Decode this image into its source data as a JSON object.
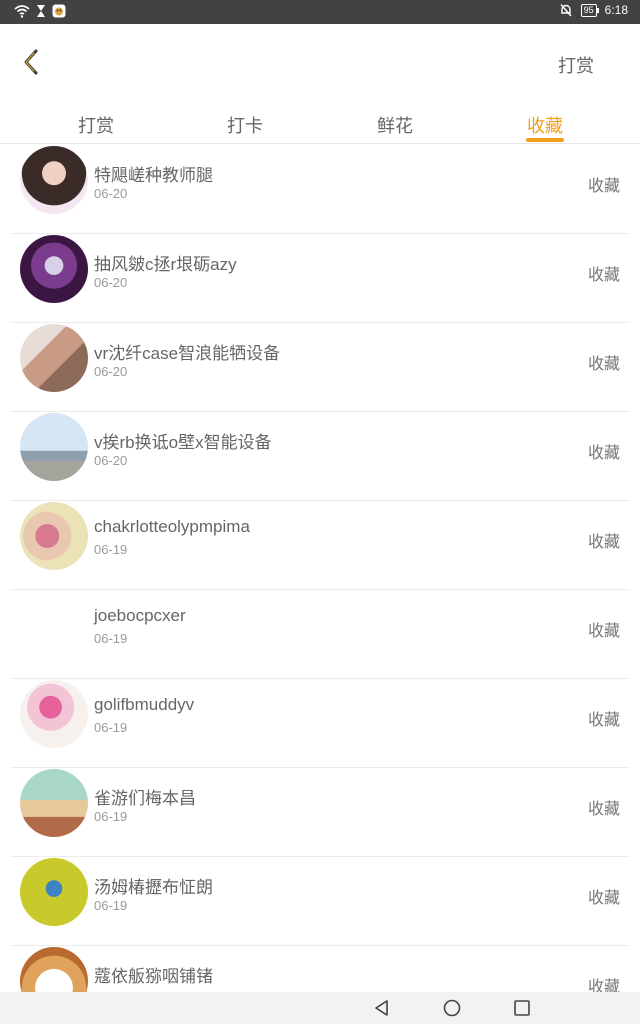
{
  "status_bar": {
    "battery": "95",
    "time": "6:18"
  },
  "header": {
    "action_label": "打赏"
  },
  "tabs": [
    {
      "label": "打赏"
    },
    {
      "label": "打卡"
    },
    {
      "label": "鲜花"
    },
    {
      "label": "收藏"
    }
  ],
  "active_tab": "收藏",
  "accent_color": "#f2a01b",
  "items": [
    {
      "name": "特飓嵯种教师腿",
      "date": "06-20",
      "action": "收藏",
      "avatar": "portrait-photo"
    },
    {
      "name": "抽风皴c拯r垠砺azy",
      "date": "06-20",
      "action": "收藏",
      "avatar": "purple-art"
    },
    {
      "name": "vr沈纤case智浪能牺设备",
      "date": "06-20",
      "action": "收藏",
      "avatar": "child-photo"
    },
    {
      "name": "v挨rb换诋o壁x智能设备",
      "date": "06-20",
      "action": "收藏",
      "avatar": "seaside-photo"
    },
    {
      "name": "chakrlotteolypmpima",
      "date": "06-19",
      "action": "收藏",
      "avatar": "flowers-photo"
    },
    {
      "name": "joebocpcxer",
      "date": "06-19",
      "action": "收藏",
      "avatar": "none"
    },
    {
      "name": "golifbmuddyv",
      "date": "06-19",
      "action": "收藏",
      "avatar": "pink-flowers"
    },
    {
      "name": "雀游们梅本昌",
      "date": "06-19",
      "action": "收藏",
      "avatar": "balloons-illustration"
    },
    {
      "name": "汤姆椿攊布怔朗",
      "date": "06-19",
      "action": "收藏",
      "avatar": "kid-yellow-field"
    },
    {
      "name": "蔻依舨猕咽铺锗",
      "date": "",
      "action": "收藏",
      "avatar": "cat-photo"
    }
  ]
}
